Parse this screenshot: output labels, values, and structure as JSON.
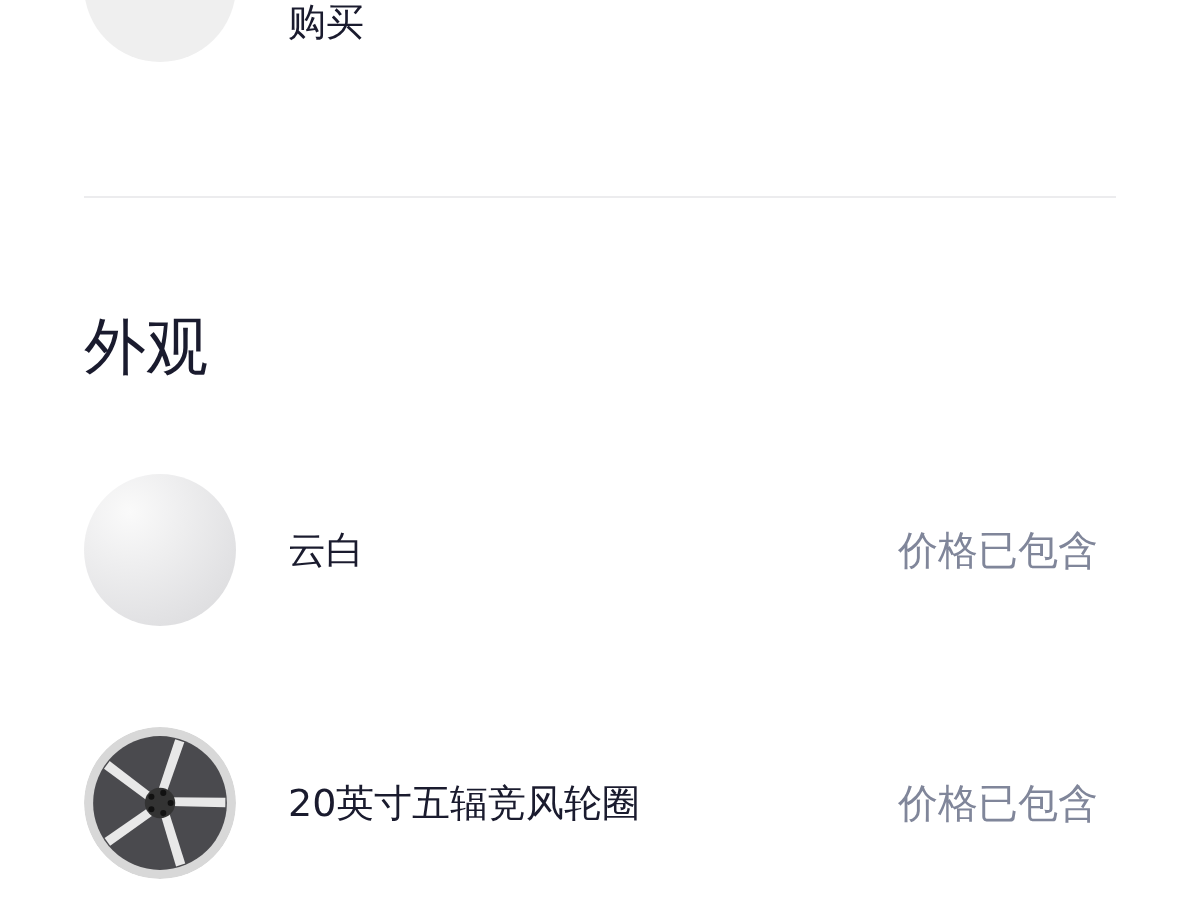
{
  "top_item": {
    "label": "购买"
  },
  "section": {
    "title": "外观"
  },
  "items": [
    {
      "kind": "color",
      "name": "云白",
      "price": "价格已包含"
    },
    {
      "kind": "wheel",
      "name": "20英寸五辐竞风轮圈",
      "price": "价格已包含"
    }
  ]
}
